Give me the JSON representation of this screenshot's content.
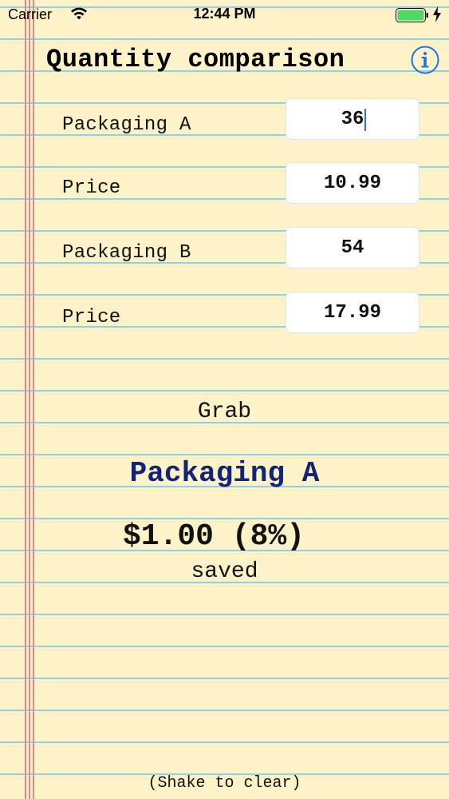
{
  "status_bar": {
    "carrier": "Carrier",
    "time": "12:44 PM",
    "battery_color": "#4cd964"
  },
  "header": {
    "title": "Quantity comparison",
    "info_icon": "info-icon",
    "accent_color": "#1a73e8"
  },
  "form": {
    "packaging_a_label": "Packaging A",
    "packaging_a_value": "36",
    "price_a_label": "Price",
    "price_a_value": "10.99",
    "packaging_b_label": "Packaging B",
    "packaging_b_value": "54",
    "price_b_label": "Price",
    "price_b_value": "17.99"
  },
  "result": {
    "grab": "Grab",
    "package": "Packaging A",
    "savings": "$1.00 (8%)",
    "saved": "saved",
    "package_color": "#12237a"
  },
  "footer": {
    "hint": "(Shake to clear)"
  }
}
